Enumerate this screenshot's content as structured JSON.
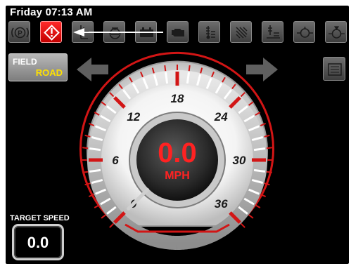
{
  "status_bar": {
    "datetime": "Friday 07:13 AM"
  },
  "icon_bar": [
    {
      "name": "parking-brake-icon"
    },
    {
      "name": "hazard-warning-icon",
      "state": "active"
    },
    {
      "name": "seat-belt-icon"
    },
    {
      "name": "oil-pressure-icon"
    },
    {
      "name": "battery-icon"
    },
    {
      "name": "engine-check-icon"
    },
    {
      "name": "coolant-temperature-icon"
    },
    {
      "name": "fuel-filter-icon"
    },
    {
      "name": "hydraulic-level-icon"
    },
    {
      "name": "transmission-icon"
    },
    {
      "name": "fuel-icon"
    }
  ],
  "mode_button": {
    "line1": "FIELD",
    "line2": "ROAD"
  },
  "speedometer": {
    "value": "0.0",
    "unit": "MPH",
    "speed": 0,
    "scale_labels": [
      "0",
      "6",
      "12",
      "18",
      "24",
      "30",
      "36"
    ]
  },
  "target_speed": {
    "label": "TARGET SPEED",
    "value": "0.0"
  },
  "colors": {
    "accent_red": "#e02020",
    "mode_road": "#ffe100",
    "background": "#000000"
  }
}
